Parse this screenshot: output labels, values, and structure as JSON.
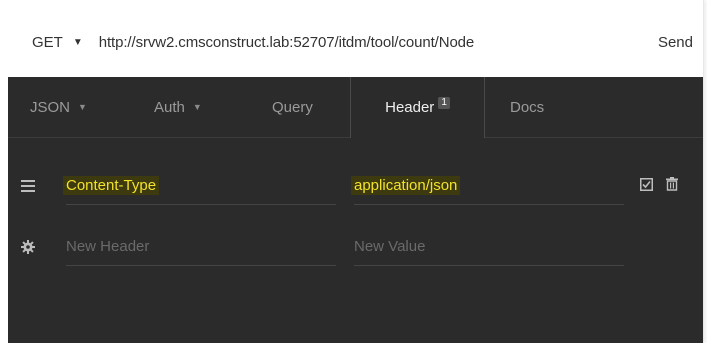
{
  "request": {
    "method": "GET",
    "url": "http://srvw2.cmsconstruct.lab:52707/itdm/tool/count/Node",
    "send_label": "Send"
  },
  "tabs": [
    {
      "label": "JSON",
      "has_dropdown": true
    },
    {
      "label": "Auth",
      "has_dropdown": true
    },
    {
      "label": "Query",
      "has_dropdown": false
    },
    {
      "label": "Header",
      "badge": "1",
      "active": true
    },
    {
      "label": "Docs",
      "has_dropdown": false
    }
  ],
  "headers": [
    {
      "name": "Content-Type",
      "value": "application/json",
      "enabled": true
    }
  ],
  "new_header": {
    "name_placeholder": "New Header",
    "value_placeholder": "New Value"
  },
  "colors": {
    "panel_bg": "#2b2b2b",
    "highlight_text": "#f2e12b",
    "highlight_bg": "#3e3a10"
  },
  "icons": {
    "drag_handle": "hamburger-icon",
    "new_row": "gear-icon",
    "enable": "checkbox-checked-icon",
    "delete": "trash-icon"
  }
}
